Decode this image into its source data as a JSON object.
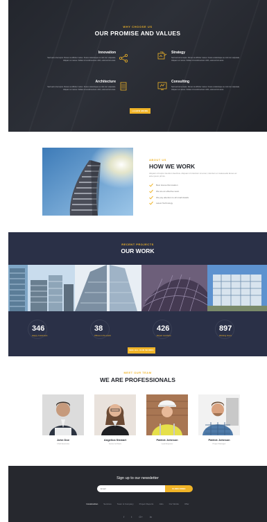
{
  "promise": {
    "kicker": "WHY CHOOSE US",
    "title": "OUR PROMISE AND VALUES",
    "features": [
      {
        "title": "Innovation",
        "text": "Sed sed urna turpis. Donec at efficitur metus. Fusce scelerisque eu nisl non vulputate. Aliquam ut metus. Nullam id condimentum nibh, euismod sit amet.",
        "icon": "network-icon"
      },
      {
        "title": "Strategy",
        "text": "Sed sed urna turpis. Donec at efficitur metus. Fusce scelerisque eu nisl non vulputate. Aliquam ut metus. Nullam id condimentum nibh, euismod sit amet.",
        "icon": "strategy-icon"
      },
      {
        "title": "Architecture",
        "text": "Sed sed urna turpis. Donec at efficitur metus. Fusce scelerisque eu nisl non vulputate. Aliquam ut metus. Nullam id condimentum nibh, euismod sit amet.",
        "icon": "building-icon"
      },
      {
        "title": "Consulting",
        "text": "Sed sed urna turpis. Donec at efficitur metus. Fusce scelerisque eu nisl non vulputate. Aliquam ut metus. Nullam id condimentum nibh, euismod sit amet.",
        "icon": "consulting-icon"
      }
    ],
    "button": "LEARN MORE"
  },
  "about": {
    "kicker": "ABOUT US",
    "title": "HOW WE WORK",
    "text": "Aliquam id turpis interdum faucibus. Aliquam id interdum sit amet, interdum et malesuada fames ac ante ipsum primis.",
    "items": [
      "Best House Renovation",
      "We are an effective team",
      "We pay attention to all small details",
      "Latest Technology"
    ]
  },
  "work": {
    "kicker": "RECENT PROJECTS",
    "title": "OUR WORK",
    "stats": [
      {
        "value": "346",
        "label": "Happy Customers"
      },
      {
        "value": "38",
        "label": "Offices in the world"
      },
      {
        "value": "426",
        "label": "Expert members"
      },
      {
        "value": "897",
        "label": "Working hours"
      }
    ],
    "button": "SEE ALL OUR WORKS"
  },
  "team": {
    "kicker": "MEET OUR TEAM",
    "title": "WE ARE PROFESSIONALS",
    "members": [
      {
        "name": "John Doe",
        "role": "Chief Executive"
      },
      {
        "name": "Angelica Stewart",
        "role": "Senior Architect"
      },
      {
        "name": "Patrick Johnson",
        "role": "Lead Engineer"
      },
      {
        "name": "Patrick Johnson",
        "role": "Project Manager"
      }
    ]
  },
  "footer": {
    "title": "Sign up to our newsletter",
    "email_placeholder": "Email",
    "subscribe": "SUBSCRIBE",
    "links": [
      "Construction",
      "Services",
      "Team & Company",
      "Project Reports",
      "Jobs",
      "Our Works",
      "Offer"
    ],
    "social": [
      "f",
      "t",
      "G+",
      "in"
    ]
  },
  "colors": {
    "accent": "#f0b428",
    "dark": "#26282e",
    "navy": "#2a3047"
  }
}
